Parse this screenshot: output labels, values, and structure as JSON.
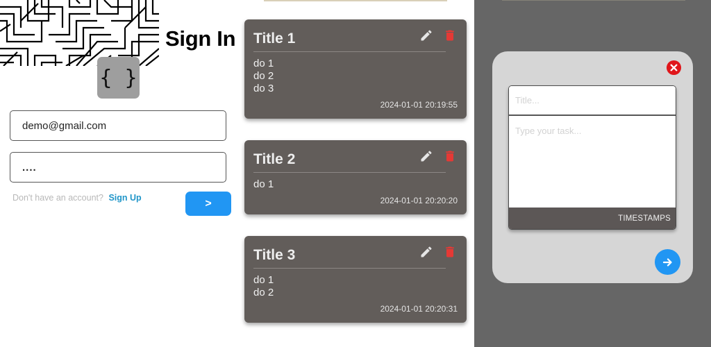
{
  "signin": {
    "title": "Sign In",
    "logo_text": "{ }",
    "email_value": "demo@gmail.com",
    "password_value": "....",
    "signup_prompt": "Don't have an account?",
    "signup_link": "Sign Up",
    "submit_label": ">"
  },
  "notes": [
    {
      "title": "Title 1",
      "lines": [
        "do 1",
        "do 2",
        "do 3"
      ],
      "timestamp": "2024-01-01 20:19:55"
    },
    {
      "title": "Title 2",
      "lines": [
        "do 1"
      ],
      "timestamp": "2024-01-01 20:20:20"
    },
    {
      "title": "Title 3",
      "lines": [
        "do 1",
        "do 2"
      ],
      "timestamp": "2024-01-01 20:20:31"
    }
  ],
  "modal": {
    "title_placeholder": "Title...",
    "task_placeholder": "Type your task...",
    "timestamps_label": "TIMESTAMPS"
  },
  "colors": {
    "accent": "#2196f3",
    "card": "#625d5a",
    "delete": "#e53935",
    "link": "#2196c9",
    "overlay": "#666666",
    "modal": "#d6d6d6",
    "close": "#e0161b"
  },
  "icons": {
    "logo": "curly-braces-icon",
    "edit": "pencil-icon",
    "delete": "trash-icon",
    "close": "close-circle-icon",
    "submit": "arrow-right-icon"
  }
}
